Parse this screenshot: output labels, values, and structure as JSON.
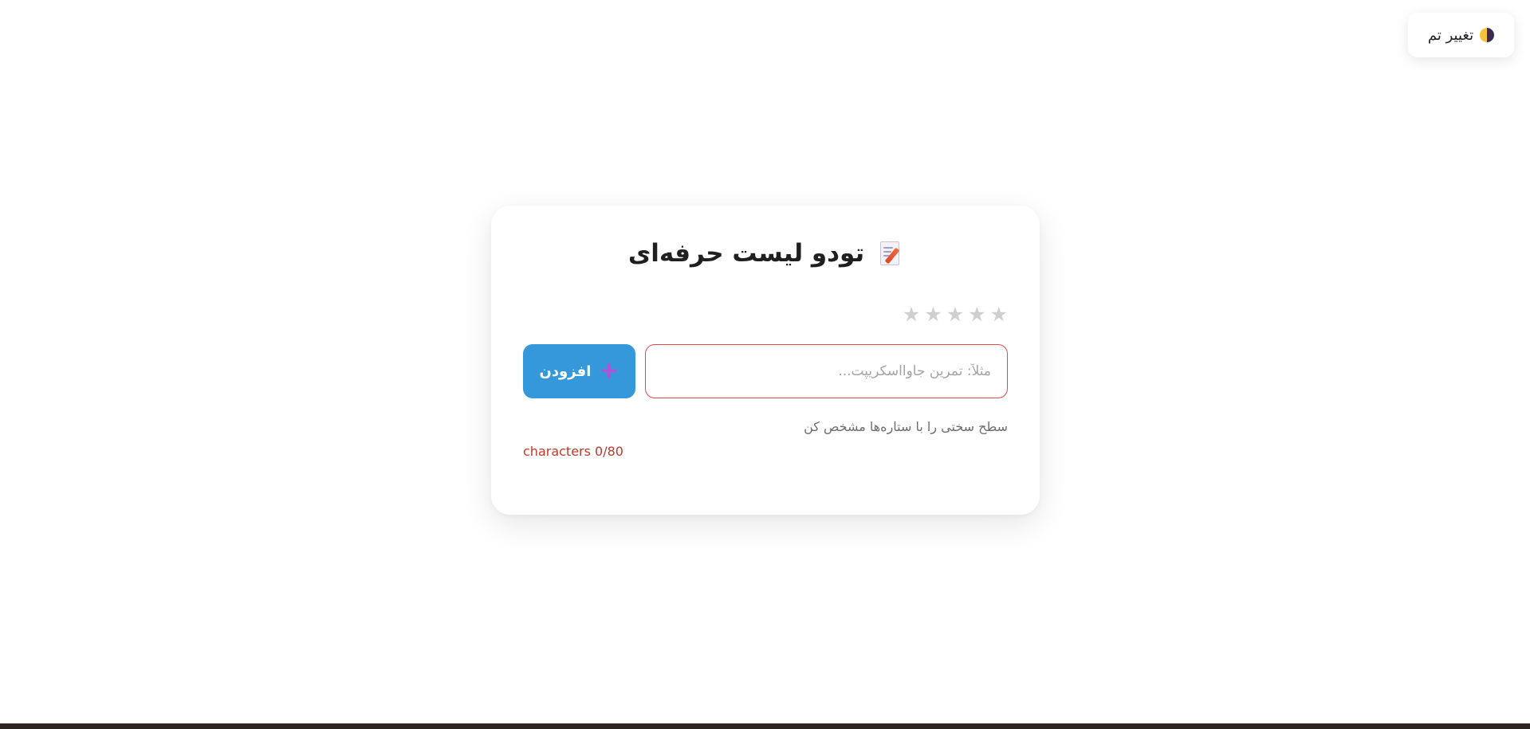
{
  "theme_toggle": {
    "label": "تغییر تم",
    "icon": "half-circle-icon"
  },
  "app": {
    "title": "تودو لیست حرفه‌ای",
    "title_icon": "memo-icon"
  },
  "difficulty": {
    "stars": [
      "★",
      "★",
      "★",
      "★",
      "★"
    ],
    "selected": 0,
    "hint": "سطح سختی را با ستاره‌ها مشخص کن"
  },
  "task_input": {
    "value": "",
    "placeholder": "مثلاً: تمرین جاوااسکریپت..."
  },
  "add_button": {
    "icon_glyph": "+",
    "label": "افزودن"
  },
  "char_counter": "characters 0/80",
  "colors": {
    "accent": "#3498db",
    "error": "#e24a4a",
    "counter_text": "#c0392b",
    "star_inactive": "#cfcfcf",
    "plus_icon": "#b84fd8"
  }
}
